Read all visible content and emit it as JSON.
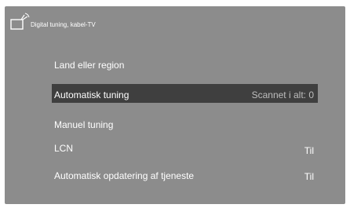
{
  "header": {
    "icon": "antenna-tv-icon",
    "title": "Digital tuning, kabel-TV"
  },
  "menu": {
    "items": [
      {
        "label": "Land eller region",
        "value": ""
      },
      {
        "label": "Automatisk tuning",
        "value": "Scannet i alt: 0",
        "selected": true
      },
      {
        "label": "Manuel tuning",
        "value": ""
      },
      {
        "label": "LCN",
        "value": "Til"
      },
      {
        "label": "Automatisk opdatering af tjeneste",
        "value": "Til"
      }
    ]
  },
  "colors": {
    "background": "#8c8c8c",
    "selected_row": "#3f3f3f",
    "text": "#ffffff"
  }
}
